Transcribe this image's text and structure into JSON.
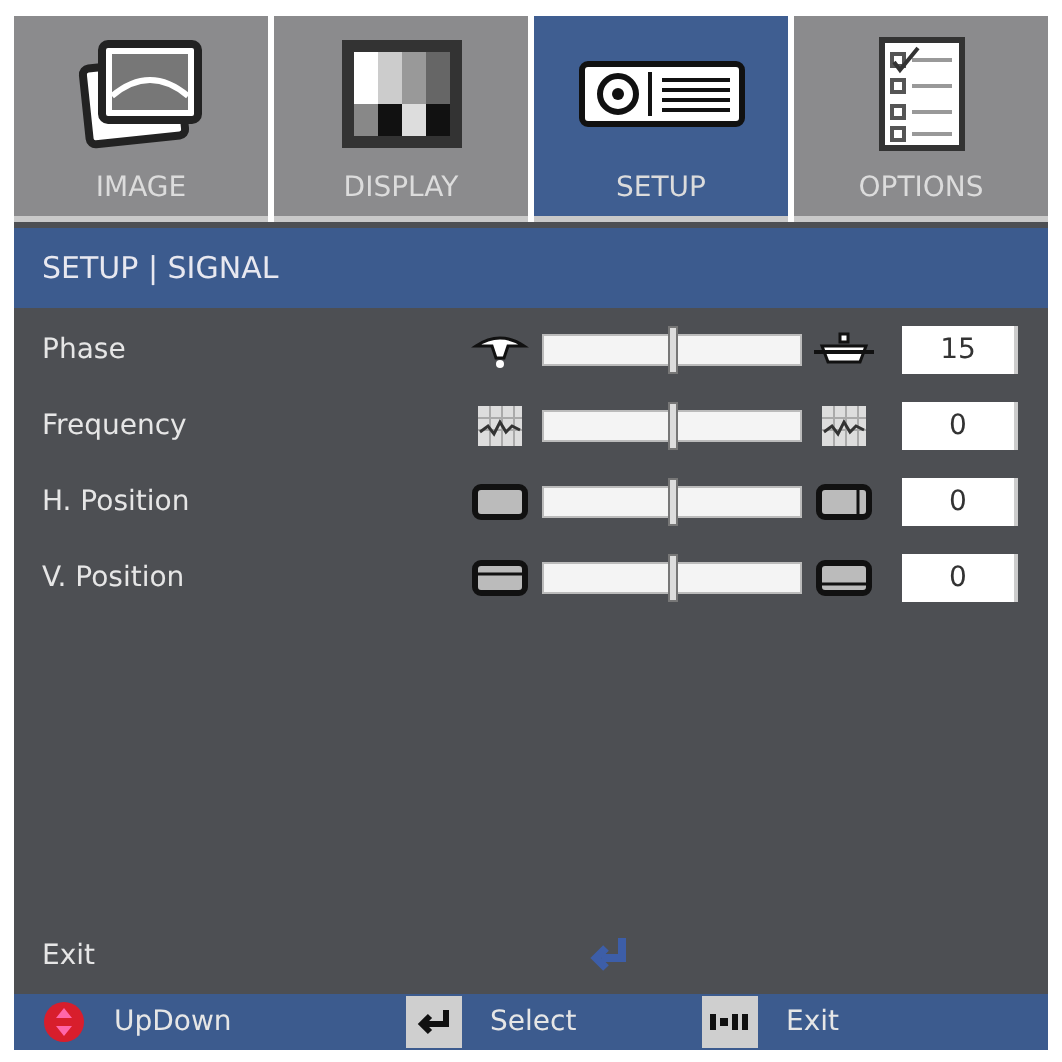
{
  "tabs": [
    {
      "label": "IMAGE",
      "selected": false
    },
    {
      "label": "DISPLAY",
      "selected": false
    },
    {
      "label": "SETUP",
      "selected": true
    },
    {
      "label": "OPTIONS",
      "selected": false
    }
  ],
  "header": "SETUP | SIGNAL",
  "rows": [
    {
      "label": "Phase",
      "level": 0.5,
      "value": "15"
    },
    {
      "label": "Frequency",
      "level": 0.5,
      "value": "0"
    },
    {
      "label": "H. Position",
      "level": 0.5,
      "value": "0"
    },
    {
      "label": "V. Position",
      "level": 0.5,
      "value": "0"
    }
  ],
  "exit": {
    "label": "Exit"
  },
  "footer": [
    {
      "kind": "updown",
      "label": "UpDown"
    },
    {
      "kind": "enter",
      "label": "Select"
    },
    {
      "kind": "menu",
      "label": "Exit"
    }
  ]
}
